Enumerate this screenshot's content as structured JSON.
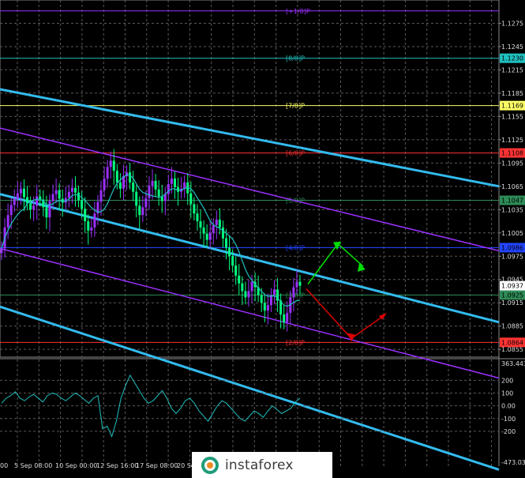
{
  "colors": {
    "bg": "#000000",
    "grid": "#5a5a5a",
    "candle_up": "#9b30ff",
    "candle_down": "#00ff7f",
    "ma": "#20c0c0",
    "channel_main": "#33bbee",
    "channel_side": "#9b30ff",
    "arrow_up": "#00dd00",
    "arrow_down": "#dd0000",
    "cci": "#20c0c0"
  },
  "chart_data": [
    {
      "type": "candlestick",
      "y_ticks": [
        "1.1275",
        "1.1245",
        "1.1215",
        "1.1185",
        "1.1155",
        "1.1125",
        "1.1095",
        "1.1065",
        "1.1035",
        "1.1005",
        "1.0975",
        "1.0945",
        "1.0915",
        "1.0885",
        "1.0855"
      ],
      "ylim": [
        1.0845,
        1.1305
      ],
      "x_ticks": [
        "00",
        "5 Sep 08:00",
        "10 Sep 00:00",
        "12 Sep 16:00",
        "17 Sep 08:00",
        "20 Se"
      ],
      "murrey_levels": [
        {
          "label": "[+1/8]P",
          "value": 1.1291,
          "color": "#9b30ff",
          "box": ""
        },
        {
          "label": "[8/8]P",
          "value": 1.123,
          "color": "#20c0c0",
          "box": "1.1230"
        },
        {
          "label": "[7/8]P",
          "value": 1.1169,
          "color": "#ffff66",
          "box": "1.1169"
        },
        {
          "label": "[6/8]P",
          "value": 1.1108,
          "color": "#ff3333",
          "box": "1.1108"
        },
        {
          "label": "[5/8]P",
          "value": 1.1047,
          "color": "#2e8b57",
          "box": "1.1047"
        },
        {
          "label": "[4/8]P",
          "value": 1.0986,
          "color": "#2244ff",
          "box": "1.0986"
        },
        {
          "label": "[3/8]P",
          "value": 1.0925,
          "color": "#2e8b57",
          "box": "1.0925"
        },
        {
          "label": "[2/8]P",
          "value": 1.0864,
          "color": "#ff3333",
          "box": "1.0864"
        }
      ],
      "current_price": "1.0937",
      "close_series": [
        1.0985,
        1.1012,
        1.1028,
        1.1041,
        1.1049,
        1.1056,
        1.1062,
        1.1051,
        1.1043,
        1.1035,
        1.104,
        1.1052,
        1.1048,
        1.1038,
        1.1025,
        1.1046,
        1.1055,
        1.106,
        1.1049,
        1.1044,
        1.105,
        1.1058,
        1.1063,
        1.1057,
        1.1047,
        1.1036,
        1.102,
        1.1008,
        1.1012,
        1.103,
        1.1045,
        1.106,
        1.1075,
        1.109,
        1.1098,
        1.1085,
        1.107,
        1.1062,
        1.1078,
        1.1083,
        1.107,
        1.1058,
        1.104,
        1.1028,
        1.1038,
        1.105,
        1.1066,
        1.1072,
        1.1061,
        1.1052,
        1.1046,
        1.1055,
        1.1068,
        1.1075,
        1.1064,
        1.1058,
        1.1062,
        1.107,
        1.1056,
        1.1042,
        1.103,
        1.102,
        1.1012,
        1.1004,
        1.0996,
        1.1005,
        1.1015,
        1.1022,
        1.1012,
        1.0998,
        1.0986,
        1.0975,
        1.0963,
        1.095,
        1.094,
        1.093,
        1.0922,
        1.093,
        1.0942,
        1.0935,
        1.0925,
        1.0915,
        1.0905,
        1.0912,
        1.0925,
        1.0932,
        1.0918,
        1.09,
        1.089,
        1.0902,
        1.0922,
        1.0935,
        1.0942,
        1.0937
      ]
    },
    {
      "type": "line",
      "name": "CCI",
      "y_ticks": [
        "363.4436",
        "200",
        "100",
        "0.00",
        "-100",
        "-200",
        "-473.0303"
      ],
      "ylim": [
        -473.0303,
        363.4436
      ],
      "values": [
        20,
        60,
        80,
        110,
        60,
        40,
        70,
        90,
        60,
        30,
        80,
        100,
        90,
        60,
        40,
        70,
        100,
        80,
        50,
        20,
        60,
        80,
        -180,
        -160,
        -240,
        -120,
        60,
        160,
        240,
        180,
        120,
        60,
        20,
        40,
        80,
        120,
        60,
        -20,
        -60,
        -20,
        40,
        60,
        20,
        -40,
        -80,
        -120,
        -60,
        0,
        40,
        20,
        -20,
        -60,
        -100,
        -120,
        -80,
        -40,
        -60,
        -90,
        -40,
        0,
        -30,
        -60,
        -40,
        -20,
        30,
        60
      ]
    }
  ],
  "watermark": "instaforex"
}
